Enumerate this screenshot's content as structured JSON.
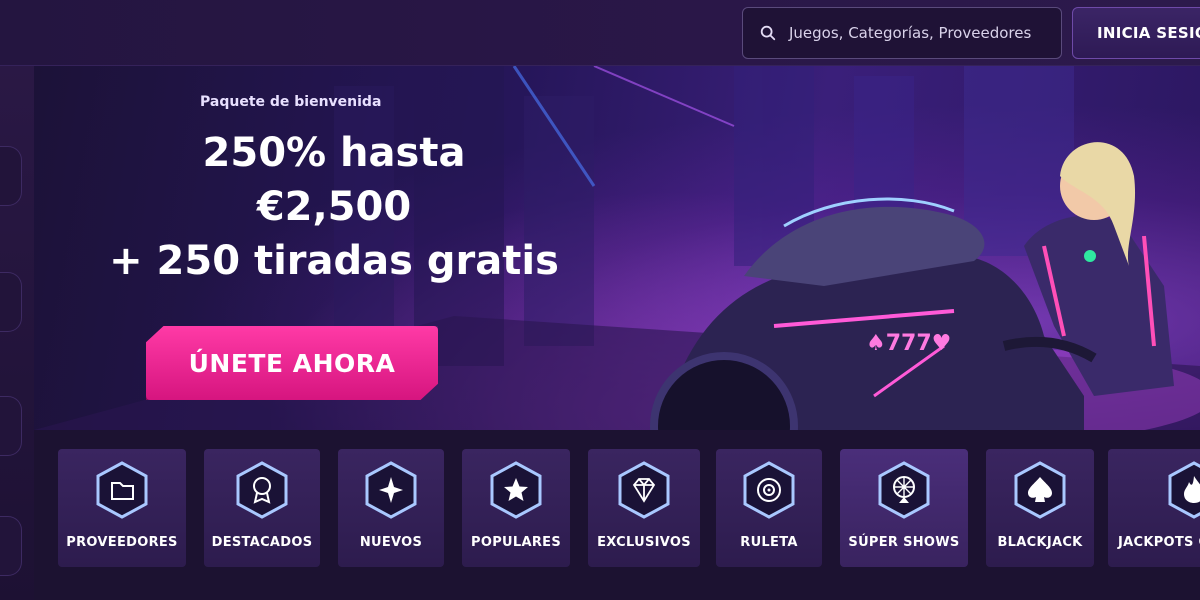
{
  "search": {
    "placeholder": "Juegos, Categorías, Proveedores",
    "icon": "search-icon"
  },
  "header": {
    "login_label": "INICIA SESIÓN"
  },
  "hero": {
    "welcome": "Paquete de bienvenida",
    "line1": "250% hasta",
    "line2": "€2,500",
    "line3": "+ 250 tiradas gratis",
    "cta": "ÚNETE AHORA",
    "accent": "#ff3aa6"
  },
  "categories": [
    {
      "label": "PROVEEDORES",
      "icon": "folder-icon"
    },
    {
      "label": "DESTACADOS",
      "icon": "award-icon"
    },
    {
      "label": "NUEVOS",
      "icon": "sparkle-icon"
    },
    {
      "label": "POPULARES",
      "icon": "star-icon"
    },
    {
      "label": "EXCLUSIVOS",
      "icon": "diamond-icon"
    },
    {
      "label": "RULETA",
      "icon": "roulette-icon"
    },
    {
      "label": "SÚPER SHOWS",
      "icon": "wheel-icon"
    },
    {
      "label": "BLACKJACK",
      "icon": "spade-icon"
    },
    {
      "label": "JACKPOTS O",
      "icon": "flame-icon"
    }
  ]
}
